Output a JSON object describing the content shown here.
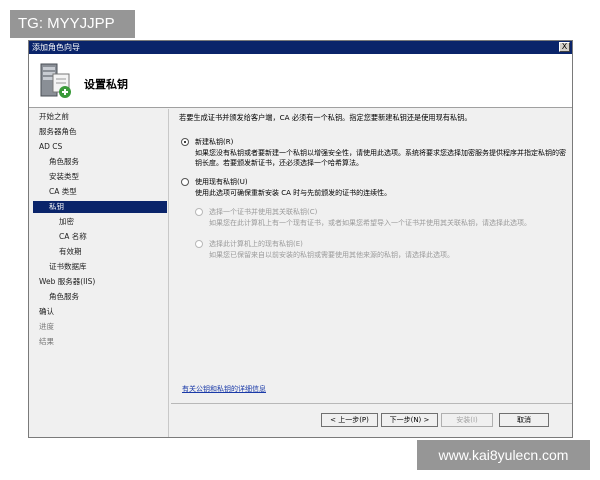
{
  "watermarks": {
    "top": "TG: MYYJJPP",
    "bottom": "www.kai8yulecn.com"
  },
  "window": {
    "title": "添加角色向导",
    "close_symbol": "X"
  },
  "header": {
    "title": "设置私钥",
    "icon": "server-certificate-icon"
  },
  "nav": {
    "items": [
      {
        "label": "开始之前"
      },
      {
        "label": "服务器角色"
      },
      {
        "label": "AD CS"
      },
      {
        "label": "角色服务"
      },
      {
        "label": "安装类型"
      },
      {
        "label": "CA 类型"
      },
      {
        "label": "私钥",
        "selected": true
      },
      {
        "label": "加密"
      },
      {
        "label": "CA 名称"
      },
      {
        "label": "有效期"
      },
      {
        "label": "证书数据库"
      },
      {
        "label": "Web 服务器(IIS)"
      },
      {
        "label": "角色服务"
      },
      {
        "label": "确认"
      },
      {
        "label": "进度"
      },
      {
        "label": "结果"
      }
    ]
  },
  "content": {
    "intro": "若要生成证书并颁发给客户端，CA 必须有一个私钥。指定您要新建私钥还是使用现有私钥。",
    "option_new": {
      "label": "新建私钥(R)",
      "desc": "如果您没有私钥或者要新建一个私钥以增强安全性，请使用此选项。系统将要求您选择加密服务提供程序并指定私钥的密钥长度。若要颁发新证书，还必须选择一个哈希算法。",
      "checked": true
    },
    "option_existing": {
      "label": "使用现有私钥(U)",
      "desc": "使用此选项可确保重新安装 CA 时与先前颁发的证书的连续性。",
      "checked": false
    },
    "sub_cert": {
      "label": "选择一个证书并使用其关联私钥(C)",
      "desc": "如果您在此计算机上有一个现有证书，或者如果您希望导入一个证书并使用其关联私钥，请选择此选项。"
    },
    "sub_key": {
      "label": "选择此计算机上的现有私钥(E)",
      "desc": "如果您已保留来自以前安装的私钥或需要使用其他来源的私钥，请选择此选项。"
    },
    "link": "有关公钥和私钥的详细信息"
  },
  "buttons": {
    "prev": "< 上一步(P)",
    "next": "下一步(N) >",
    "install": "安装(I)",
    "cancel": "取消"
  }
}
